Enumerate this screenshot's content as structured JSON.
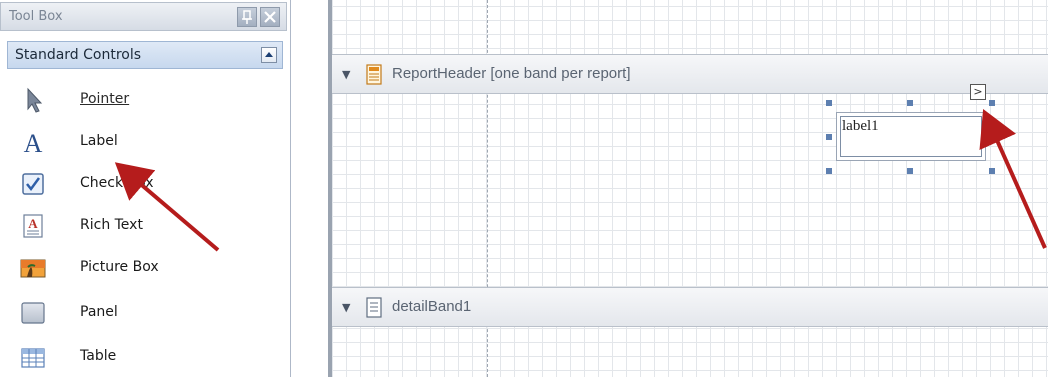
{
  "toolbox": {
    "title": "Tool Box",
    "pin_glyph": "↕",
    "close_glyph": "✕",
    "category": {
      "label": "Standard Controls",
      "toggle_glyph": "▲"
    },
    "items": [
      {
        "label": "Pointer",
        "icon": "pointer-icon"
      },
      {
        "label": "Label",
        "icon": "label-icon"
      },
      {
        "label": "Check Box",
        "icon": "checkbox-icon"
      },
      {
        "label": "Rich Text",
        "icon": "rich-text-icon"
      },
      {
        "label": "Picture Box",
        "icon": "picture-box-icon"
      },
      {
        "label": "Panel",
        "icon": "panel-icon"
      },
      {
        "label": "Table",
        "icon": "table-icon"
      }
    ]
  },
  "designer": {
    "bands": [
      {
        "label": "ReportHeader [one band per report]",
        "collapse_glyph": "▼",
        "icon": "report-header-band-icon"
      },
      {
        "label": "detailBand1",
        "collapse_glyph": "▼",
        "icon": "detail-band-icon"
      }
    ],
    "label_control": {
      "text": "label1",
      "smart_tag_glyph": ">"
    }
  },
  "colors": {
    "annotation_arrow": "#b51c1c",
    "selection_handle": "#5d7fb0",
    "category_header": "#c7d8ee"
  }
}
